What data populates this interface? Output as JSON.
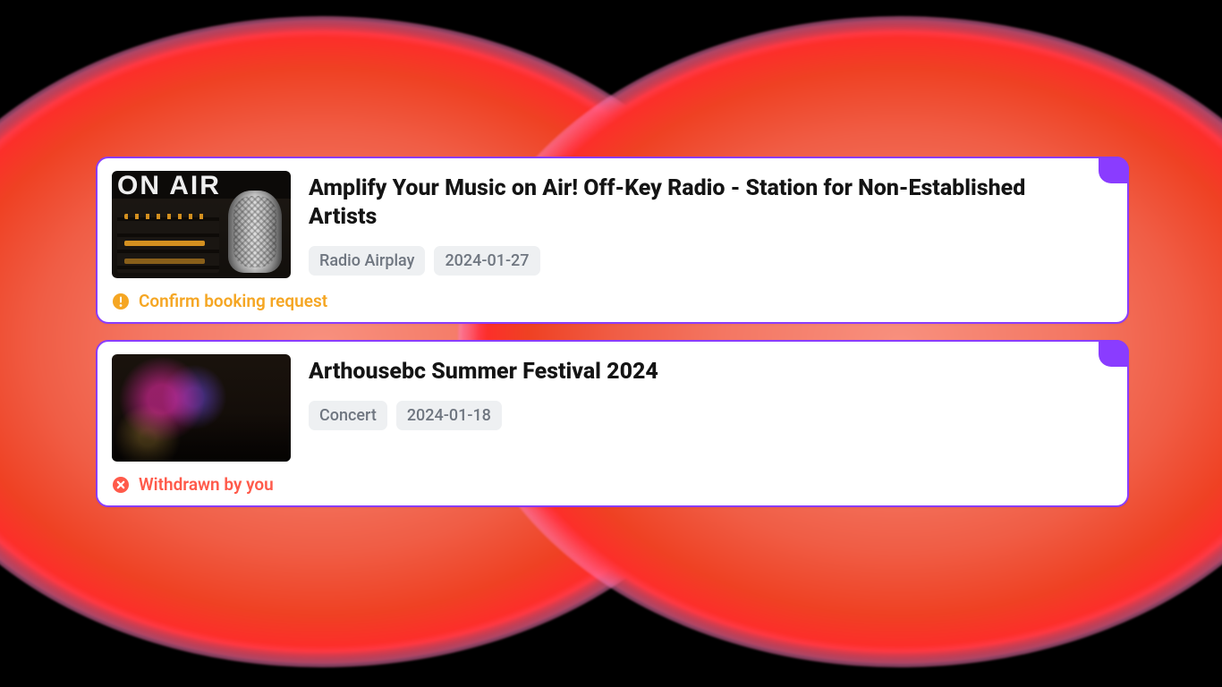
{
  "colors": {
    "accent_purple": "#8a3cff",
    "status_pending": "#f5a623",
    "status_withdrawn": "#ff5a4a"
  },
  "cards": [
    {
      "title": "Amplify Your Music on Air! Off-Key Radio - Station for Non-Established Artists",
      "category": "Radio Airplay",
      "date": "2024-01-27",
      "status_text": "Confirm booking request",
      "status_kind": "pending",
      "thumb": "onair",
      "thumb_text": "ON AIR"
    },
    {
      "title": "Arthousebc Summer Festival 2024",
      "category": "Concert",
      "date": "2024-01-18",
      "status_text": "Withdrawn by you",
      "status_kind": "withdrawn",
      "thumb": "venue",
      "thumb_text": ""
    }
  ]
}
